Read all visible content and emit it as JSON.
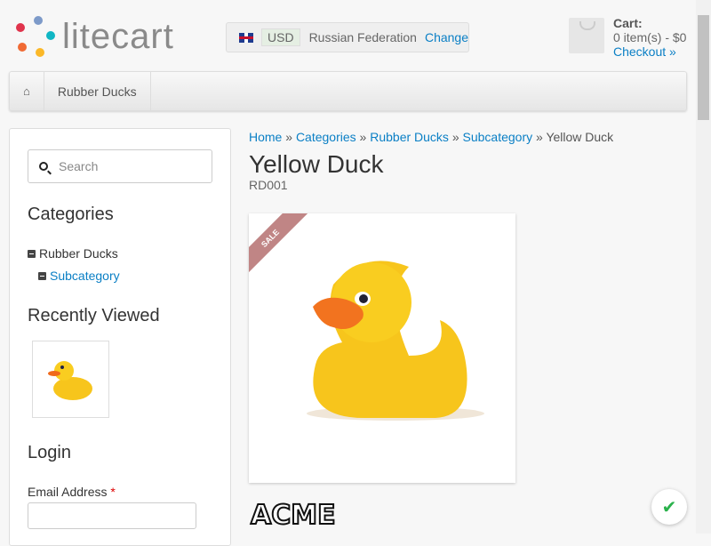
{
  "logo": "litecart",
  "region": {
    "currency": "USD",
    "country": "Russian Federation",
    "change": "Change"
  },
  "cart": {
    "title": "Cart:",
    "summary": "0 item(s) - $0",
    "checkout": "Checkout »"
  },
  "nav": {
    "home_icon": "home-icon",
    "items": [
      "Rubber Ducks"
    ]
  },
  "sidebar": {
    "search_placeholder": "Search",
    "categories_title": "Categories",
    "categories": [
      "Rubber Ducks",
      "Subcategory"
    ],
    "recently_viewed": "Recently Viewed",
    "login_title": "Login",
    "email_label": "Email Address",
    "required": "*"
  },
  "breadcrumb": [
    "Home",
    "Categories",
    "Rubber Ducks",
    "Subcategory",
    "Yellow Duck"
  ],
  "sep": "»",
  "product": {
    "name": "Yellow Duck",
    "sku": "RD001",
    "badge": "SALE",
    "brand": "ACME"
  },
  "colors": {
    "link": "#0a7fc5",
    "sale": "#c08585"
  }
}
